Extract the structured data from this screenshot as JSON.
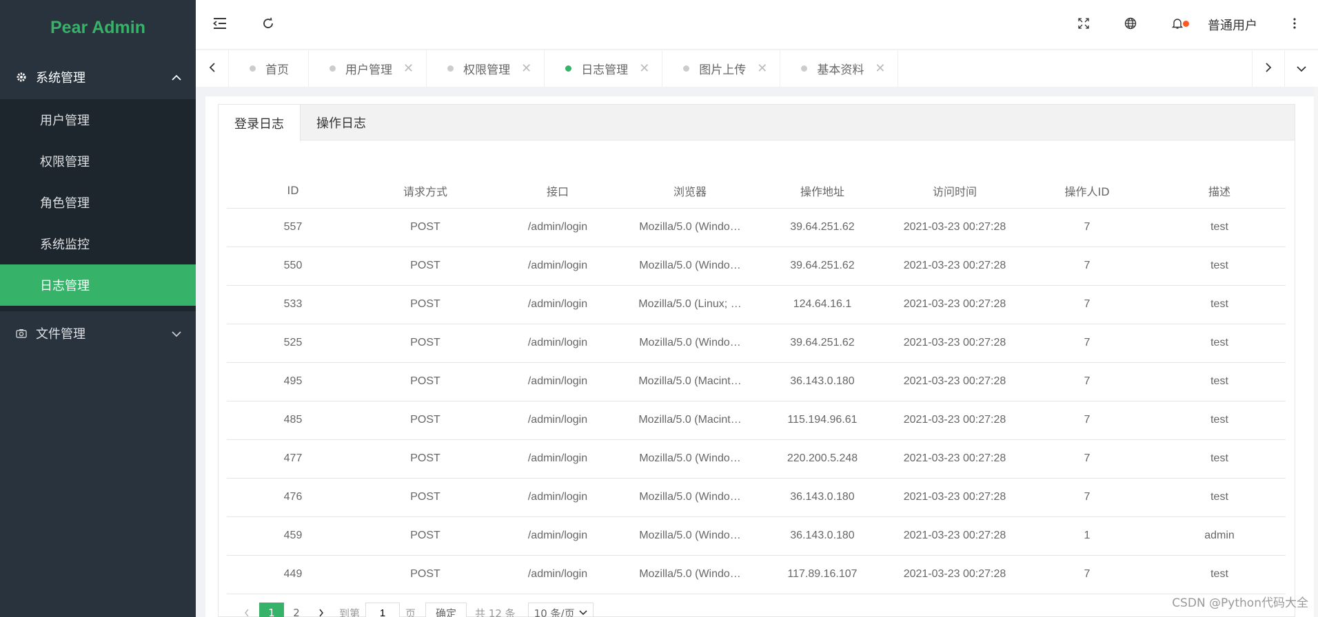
{
  "app": {
    "logo": "Pear Admin"
  },
  "sidebar": {
    "groups": [
      {
        "label": "系统管理",
        "icon": "gear-icon",
        "expanded": true,
        "items": [
          {
            "label": "用户管理"
          },
          {
            "label": "权限管理"
          },
          {
            "label": "角色管理"
          },
          {
            "label": "系统监控"
          },
          {
            "label": "日志管理",
            "active": true
          }
        ]
      },
      {
        "label": "文件管理",
        "icon": "camera-icon",
        "expanded": false
      }
    ]
  },
  "header": {
    "username": "普通用户"
  },
  "tabs": [
    {
      "label": "首页",
      "closable": false
    },
    {
      "label": "用户管理",
      "closable": true
    },
    {
      "label": "权限管理",
      "closable": true
    },
    {
      "label": "日志管理",
      "closable": true,
      "active": true
    },
    {
      "label": "图片上传",
      "closable": true
    },
    {
      "label": "基本资料",
      "closable": true
    }
  ],
  "content_tabs": [
    {
      "label": "登录日志",
      "active": true
    },
    {
      "label": "操作日志"
    }
  ],
  "table": {
    "columns": [
      "ID",
      "请求方式",
      "接口",
      "浏览器",
      "操作地址",
      "访问时间",
      "操作人ID",
      "描述"
    ],
    "rows": [
      [
        "557",
        "POST",
        "/admin/login",
        "Mozilla/5.0 (Windo…",
        "39.64.251.62",
        "2021-03-23 00:27:28",
        "7",
        "test"
      ],
      [
        "550",
        "POST",
        "/admin/login",
        "Mozilla/5.0 (Windo…",
        "39.64.251.62",
        "2021-03-23 00:27:28",
        "7",
        "test"
      ],
      [
        "533",
        "POST",
        "/admin/login",
        "Mozilla/5.0 (Linux; …",
        "124.64.16.1",
        "2021-03-23 00:27:28",
        "7",
        "test"
      ],
      [
        "525",
        "POST",
        "/admin/login",
        "Mozilla/5.0 (Windo…",
        "39.64.251.62",
        "2021-03-23 00:27:28",
        "7",
        "test"
      ],
      [
        "495",
        "POST",
        "/admin/login",
        "Mozilla/5.0 (Macint…",
        "36.143.0.180",
        "2021-03-23 00:27:28",
        "7",
        "test"
      ],
      [
        "485",
        "POST",
        "/admin/login",
        "Mozilla/5.0 (Macint…",
        "115.194.96.61",
        "2021-03-23 00:27:28",
        "7",
        "test"
      ],
      [
        "477",
        "POST",
        "/admin/login",
        "Mozilla/5.0 (Windo…",
        "220.200.5.248",
        "2021-03-23 00:27:28",
        "7",
        "test"
      ],
      [
        "476",
        "POST",
        "/admin/login",
        "Mozilla/5.0 (Windo…",
        "36.143.0.180",
        "2021-03-23 00:27:28",
        "7",
        "test"
      ],
      [
        "459",
        "POST",
        "/admin/login",
        "Mozilla/5.0 (Windo…",
        "36.143.0.180",
        "2021-03-23 00:27:28",
        "1",
        "admin"
      ],
      [
        "449",
        "POST",
        "/admin/login",
        "Mozilla/5.0 (Windo…",
        "117.89.16.107",
        "2021-03-23 00:27:28",
        "7",
        "test"
      ]
    ]
  },
  "pagination": {
    "pages": [
      "1",
      "2"
    ],
    "current": "1",
    "goto_prefix": "到第",
    "goto_value": "1",
    "goto_suffix": "页",
    "confirm": "确定",
    "total": "共 12 条",
    "page_size": "10 条/页"
  },
  "watermark": "CSDN @Python代码大全",
  "colors": {
    "accent": "#36b368",
    "sidebar_bg": "#28333e",
    "submenu_bg": "#1d252d",
    "notify_dot": "#ff5722"
  }
}
